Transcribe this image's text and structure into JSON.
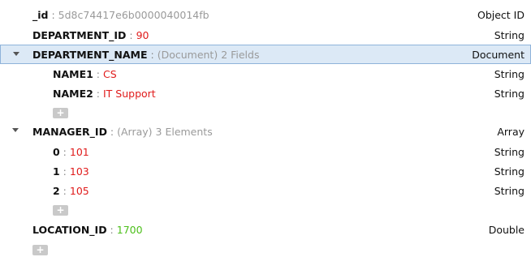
{
  "rows": {
    "id": {
      "key": "_id",
      "sep": " : ",
      "value": "5d8c74417e6b0000040014fb",
      "type": "Object ID"
    },
    "department_id": {
      "key": "DEPARTMENT_ID",
      "sep": " : ",
      "value": "90",
      "type": "String"
    },
    "department_name": {
      "key": "DEPARTMENT_NAME",
      "sep": " : ",
      "value": "(Document) 2 Fields",
      "type": "Document"
    },
    "name1": {
      "key": "NAME1",
      "sep": " : ",
      "value": "CS",
      "type": "String"
    },
    "name2": {
      "key": "NAME2",
      "sep": " : ",
      "value": "IT Support",
      "type": "String"
    },
    "manager_id": {
      "key": "MANAGER_ID",
      "sep": " : ",
      "value": "(Array) 3 Elements",
      "type": "Array"
    },
    "m0": {
      "key": "0",
      "sep": " : ",
      "value": "101",
      "type": "String"
    },
    "m1": {
      "key": "1",
      "sep": " : ",
      "value": "103",
      "type": "String"
    },
    "m2": {
      "key": "2",
      "sep": " : ",
      "value": "105",
      "type": "String"
    },
    "location_id": {
      "key": "LOCATION_ID",
      "sep": " : ",
      "value": "1700",
      "type": "Double"
    }
  },
  "add_button_glyph": "+",
  "icons": {
    "expand": "caret-down-icon",
    "add": "plus-icon"
  },
  "colors": {
    "string_value": "#e01b1b",
    "number_value": "#4cbf1a",
    "meta_value": "#9a9a9a",
    "selected_row": "#dce9f6"
  }
}
